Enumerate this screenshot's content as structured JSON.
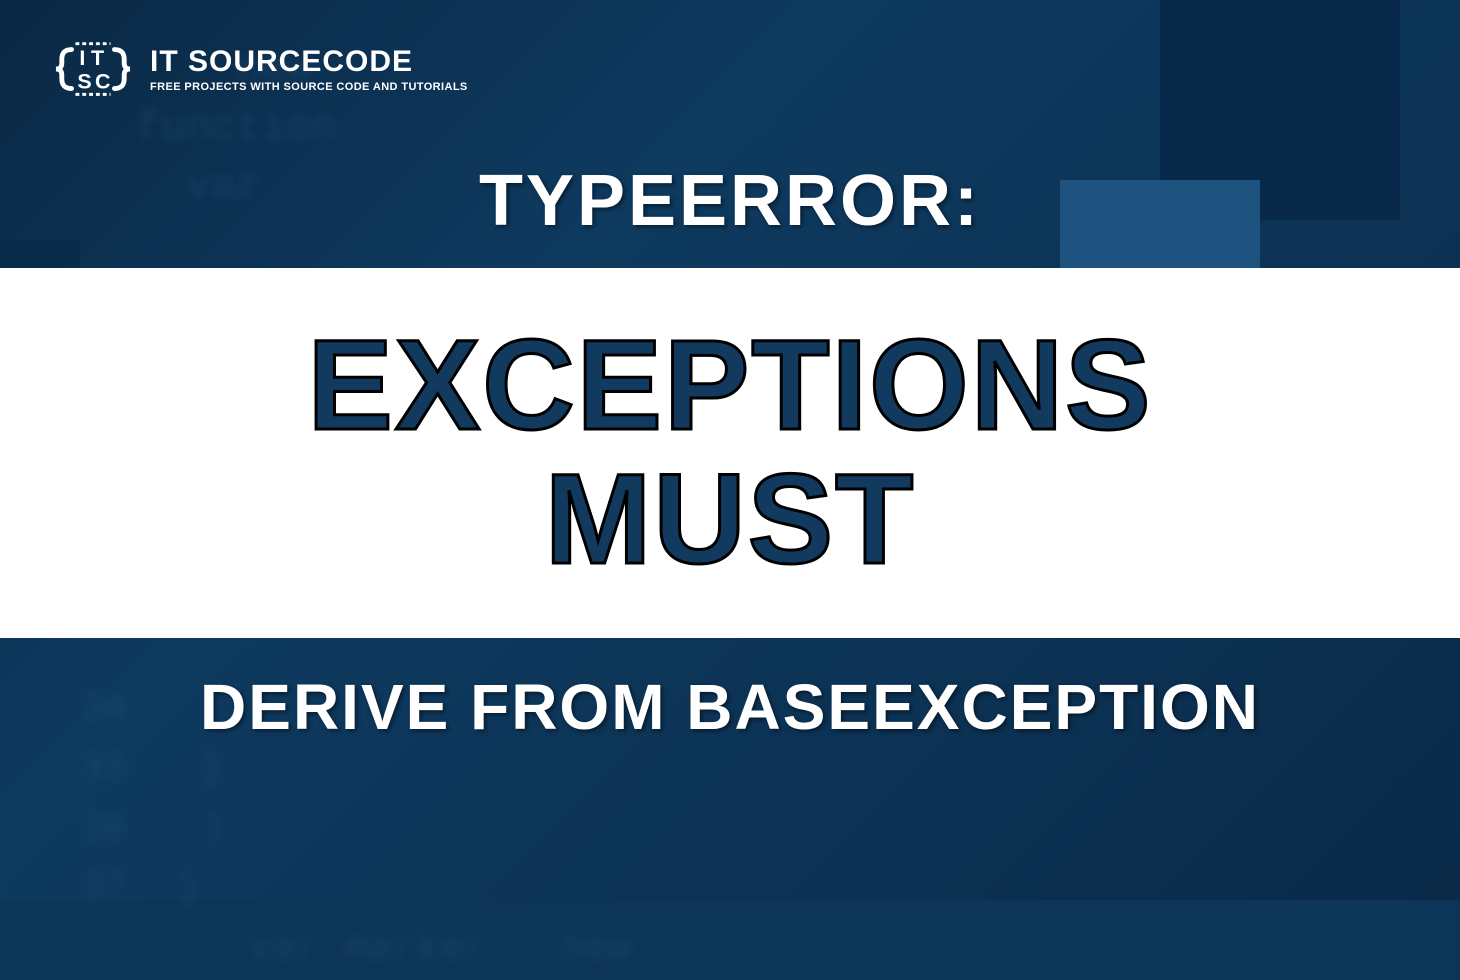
{
  "logo": {
    "title": "IT SOURCECODE",
    "subtitle": "FREE PROJECTS WITH SOURCE CODE AND TUTORIALS"
  },
  "heading": "TYPEERROR:",
  "main_words": {
    "line1": "EXCEPTIONS",
    "line2": "MUST"
  },
  "footer": "DERIVE FROM BASEEXCEPTION",
  "bg_code_top": "       new\n   function\n     var",
  "bg_code_bottom": "34\n35   }\n36   )\n37  }\n       var marker   new"
}
